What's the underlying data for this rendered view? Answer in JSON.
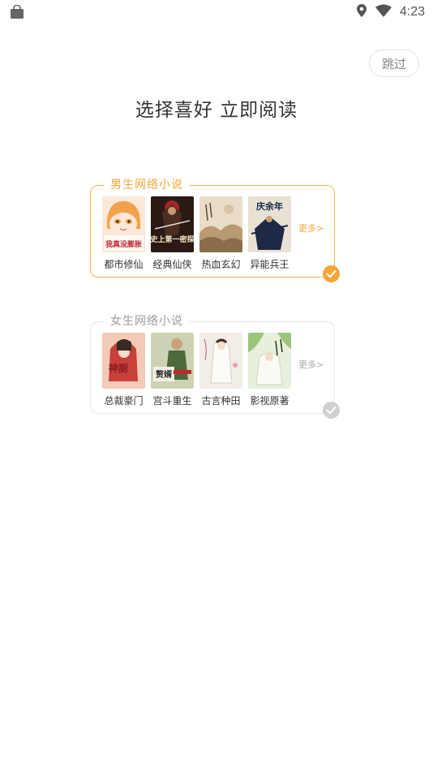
{
  "status_bar": {
    "time": "4:23"
  },
  "skip_label": "跳过",
  "title": "选择喜好 立即阅读",
  "colors": {
    "accent": "#f5a53a",
    "unselected": "#d0d0d0"
  },
  "male_section": {
    "title": "男生网络小说",
    "more_label": "更多>",
    "selected": true,
    "books": [
      {
        "label": "都市修仙",
        "cover_text": "我真没膨胀"
      },
      {
        "label": "经典仙侠",
        "cover_text": "史上第一密探"
      },
      {
        "label": "热血玄幻",
        "cover_text": ""
      },
      {
        "label": "异能兵王",
        "cover_text": "庆余年"
      }
    ]
  },
  "female_section": {
    "title": "女生网络小说",
    "more_label": "更多>",
    "selected": false,
    "books": [
      {
        "label": "总裁豪门",
        "cover_text": "神厨"
      },
      {
        "label": "宫斗重生",
        "cover_text": "赘婿"
      },
      {
        "label": "古言种田",
        "cover_text": ""
      },
      {
        "label": "影视原著",
        "cover_text": ""
      }
    ]
  }
}
